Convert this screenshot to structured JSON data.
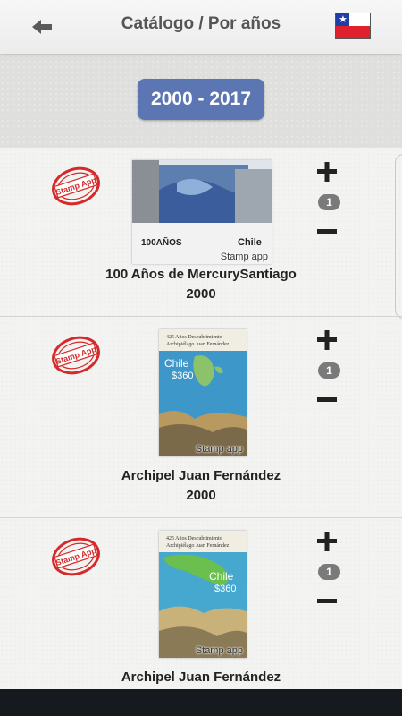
{
  "header": {
    "title": "Catálogo / Por años",
    "back_icon": "arrow-left-icon",
    "flag_icon": "chile-flag-icon"
  },
  "year_range": {
    "label": "2000 - 2017"
  },
  "colors": {
    "range_button": "#5b76b3",
    "seal_red": "#d62a2a",
    "count_badge": "#7a7a7a"
  },
  "items": [
    {
      "name": "100 Años de MercurySantiago",
      "year": "2000",
      "count": "1",
      "watermark": "Stamp app",
      "seal_text": "Stamp App",
      "stamp_text": {
        "brand": "100AÑOS",
        "country": "Chile"
      }
    },
    {
      "name": "Archipel Juan Fernández",
      "year": "2000",
      "count": "1",
      "watermark": "Stamp app",
      "seal_text": "Stamp App",
      "stamp_text": {
        "line1": "425 Años Descubrimiento",
        "line2": "Archipiélago Juan Fernández",
        "country": "Chile",
        "value": "$360"
      }
    },
    {
      "name": "Archipel Juan Fernández",
      "year": "",
      "count": "1",
      "watermark": "Stamp app",
      "seal_text": "Stamp App",
      "stamp_text": {
        "line1": "425 Años Descubrimiento",
        "line2": "Archipiélago Juan Fernández",
        "country": "Chile",
        "value": "$360"
      }
    }
  ]
}
